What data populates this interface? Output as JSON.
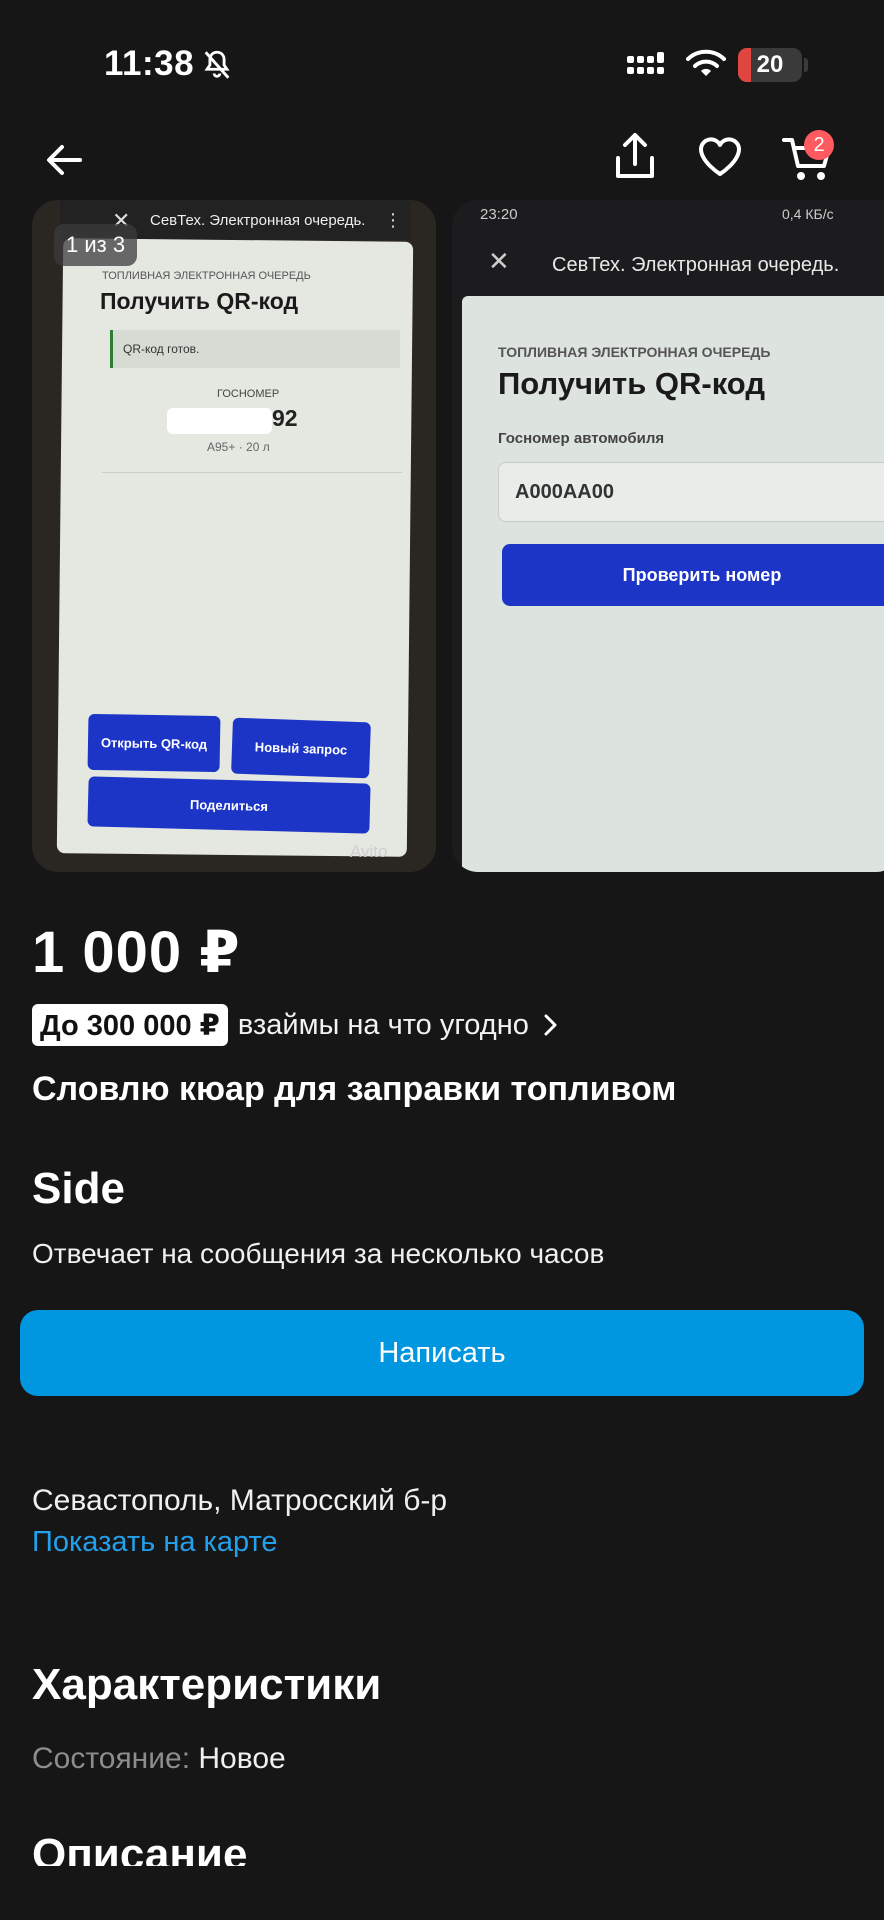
{
  "status_bar": {
    "time": "11:38",
    "battery": "20",
    "battery_level": 0.2
  },
  "nav": {
    "cart_count": "2"
  },
  "gallery": {
    "counter": "1 из 3",
    "photo1": {
      "app_title": "СевТех. Электронная очередь.",
      "section": "ТОПЛИВНАЯ ЭЛЕКТРОННАЯ ОЧЕРЕДЬ",
      "heading": "Получить QR-код",
      "status": "QR-код готов.",
      "plate_label": "ГОСНОМЕР",
      "plate_suffix": "92",
      "fuel": "А95+ · 20 л",
      "btn_open": "Открыть QR-код",
      "btn_new": "Новый запрос",
      "btn_share": "Поделиться",
      "watermark": "Avito"
    },
    "photo2": {
      "time": "23:20",
      "net": "0,4 КБ/с",
      "app_title": "СевТех. Электронная очередь.",
      "section": "ТОПЛИВНАЯ ЭЛЕКТРОННАЯ ОЧЕРЕДЬ",
      "heading": "Получить QR-код",
      "plate_label": "Госномер автомобиля",
      "plate_value": "А000АА00",
      "btn_check": "Проверить номер"
    }
  },
  "listing": {
    "price": "1 000 ₽",
    "loan_badge": "До 300 000 ₽",
    "loan_text": "взаймы на что угодно",
    "title": "Словлю кюар для заправки топливом",
    "seller_name": "Side",
    "reply_time": "Отвечает на сообщения за несколько часов",
    "write_button": "Написать",
    "address": "Севастополь, Матросский б-р",
    "map_link": "Показать на карте",
    "characteristics_heading": "Характеристики",
    "condition_label": "Состояние:",
    "condition_value": "Новое",
    "description_heading": "Описание"
  },
  "colors": {
    "background": "#161616",
    "accent_blue": "#0097e0",
    "link_blue": "#23a0ec",
    "badge_red": "#ff5a5f"
  }
}
